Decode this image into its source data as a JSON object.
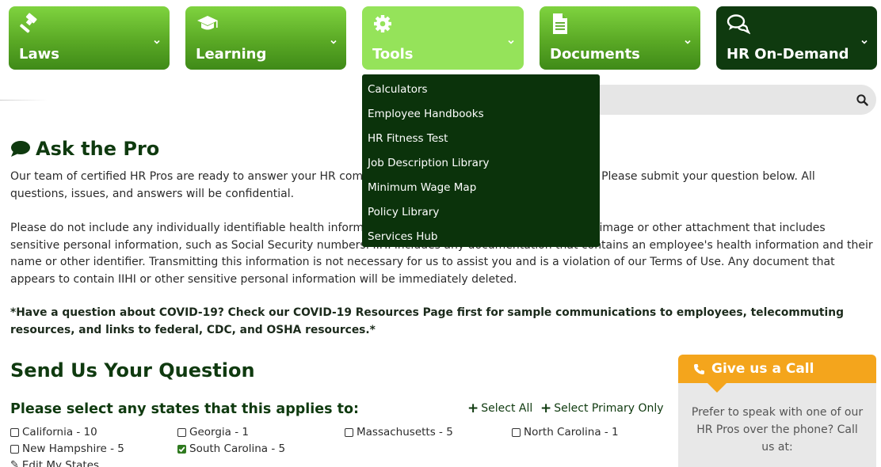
{
  "nav": [
    {
      "label": "Laws",
      "icon": "gavel-icon"
    },
    {
      "label": "Learning",
      "icon": "graduation-cap-icon"
    },
    {
      "label": "Tools",
      "icon": "gear-icon"
    },
    {
      "label": "Documents",
      "icon": "document-icon"
    },
    {
      "label": "HR On-Demand",
      "icon": "chat-bubbles-icon"
    }
  ],
  "dropdown": {
    "items": [
      "Calculators",
      "Employee Handbooks",
      "HR Fitness Test",
      "Job Description Library",
      "Minimum Wage Map",
      "Policy Library",
      "Services Hub"
    ]
  },
  "content": {
    "title": "Ask the Pro",
    "para1": "Our team of certified HR Pros are ready to answer your HR compliance and employee relations questions. Please submit your question below. All questions, issues, and answers will be confidential.",
    "para2": "Please do not include any individually identifiable health information (IIHI) in your question or upload any image or other attachment that includes sensitive personal information, such as Social Security numbers. IIHI includes any documentation that contains an employee's health information and their name or other identifier. Transmitting this information is not necessary for us to assist you and is a violation of our Terms of Use. Any document that appears to contain IIHI or other sensitive personal information will be immediately deleted.",
    "covid_note": "*Have a question about COVID-19? Check our COVID-19 Resources Page first for sample communications to employees, telecommuting resources, and links to federal, CDC, and OSHA resources.*"
  },
  "question": {
    "title": "Send Us Your Question",
    "states_heading": "Please select any states that this applies to:",
    "select_all": "Select All",
    "select_primary": "Select Primary Only",
    "states": [
      {
        "label": "California - 10",
        "checked": false
      },
      {
        "label": "Georgia - 1",
        "checked": false
      },
      {
        "label": "Massachusetts - 5",
        "checked": false
      },
      {
        "label": "North Carolina - 1",
        "checked": false
      },
      {
        "label": "New Hampshire - 5",
        "checked": false
      },
      {
        "label": "South Carolina - 5",
        "checked": true
      }
    ],
    "edit_states": "Edit My States"
  },
  "callbox": {
    "title": "Give us a Call",
    "body": "Prefer to speak with one of our HR Pros over the phone? Call us at:"
  },
  "colors": {
    "nav_green": "#5aa925",
    "nav_active": "#95e35a",
    "nav_dark": "#0f3a0f",
    "dropdown_bg": "#0b330b",
    "heading_green": "#0f3a0f",
    "call_orange": "#f4a51c"
  }
}
